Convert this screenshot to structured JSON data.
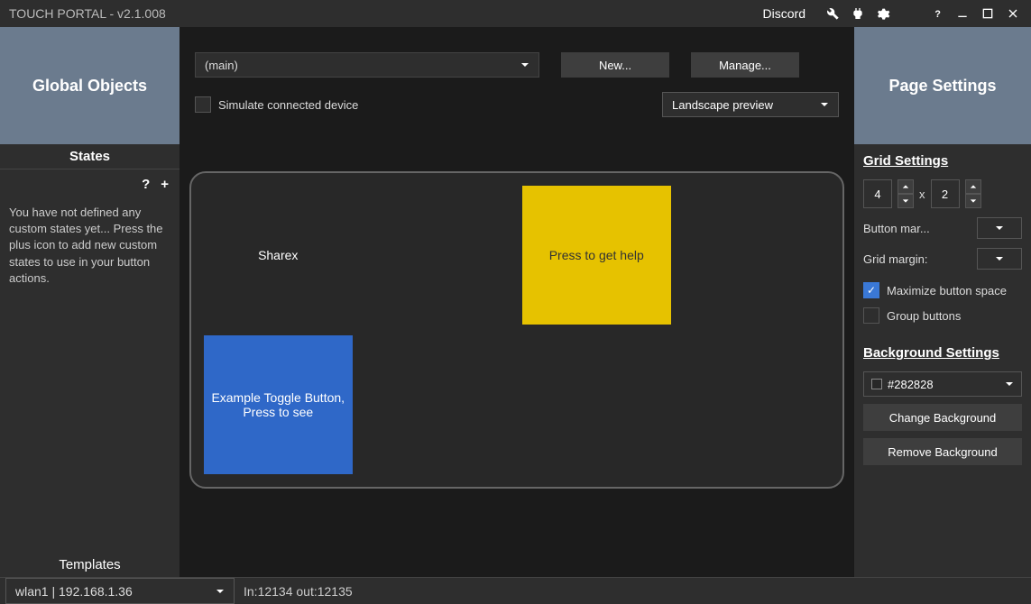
{
  "titlebar": {
    "title": "TOUCH PORTAL - v2.1.008",
    "discord": "Discord"
  },
  "left": {
    "header": "Global Objects",
    "states_header": "States",
    "states_text": "You have not defined any custom states yet... Press the plus icon to add new custom states to use in your button actions.",
    "templates_header": "Templates"
  },
  "center": {
    "page_selected": "(main)",
    "new_btn": "New...",
    "manage_btn": "Manage...",
    "simulate_label": "Simulate connected device",
    "preview_mode": "Landscape preview",
    "cells": {
      "sharex": "Sharex",
      "toggle": "Example Toggle Button, Press to see",
      "help": "Press to get help"
    }
  },
  "right": {
    "header": "Page Settings",
    "grid_section": "Grid Settings",
    "cols": "4",
    "rows": "2",
    "button_margin_label": "Button mar...",
    "grid_margin_label": "Grid margin:",
    "maximize_label": "Maximize button space",
    "group_label": "Group buttons",
    "bg_section": "Background Settings",
    "bg_color": "#282828",
    "change_bg": "Change Background",
    "remove_bg": "Remove Background"
  },
  "status": {
    "network": "wlan1 | 192.168.1.36",
    "io": "In:12134 out:12135"
  }
}
